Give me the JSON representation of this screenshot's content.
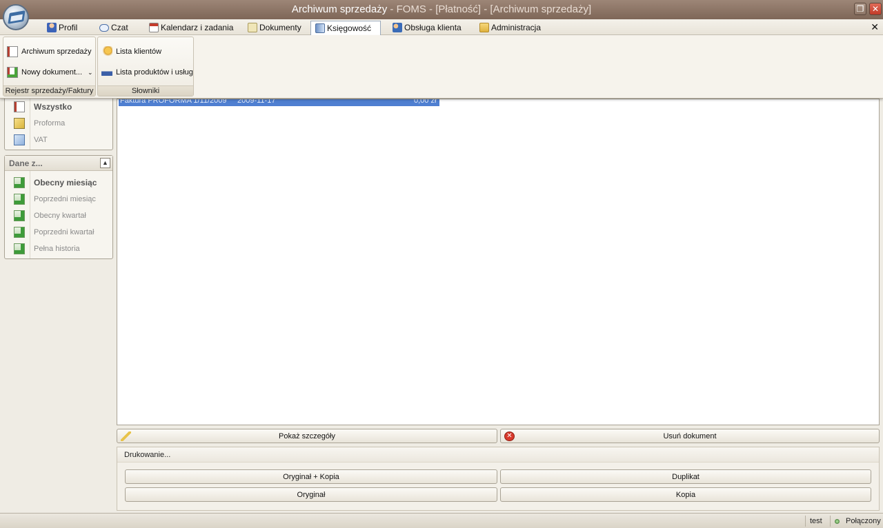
{
  "window": {
    "title_main": "Archiwum sprzedaży",
    "title_rest": " - FOMS - [Płatność] - [Archiwum sprzedaży]"
  },
  "tabs": [
    {
      "label": "Profil"
    },
    {
      "label": "Czat"
    },
    {
      "label": "Kalendarz i zadania"
    },
    {
      "label": "Dokumenty"
    },
    {
      "label": "Księgowość"
    },
    {
      "label": "Obsługa klienta"
    },
    {
      "label": "Administracja"
    }
  ],
  "ribbon": {
    "group1": {
      "caption": "Rejestr sprzedaży/Faktury",
      "archive_label": "Archiwum sprzedaży",
      "new_doc_label": "Nowy dokument..."
    },
    "group2": {
      "caption": "Słowniki",
      "clients_label": "Lista klientów",
      "products_label": "Lista produktów i usług"
    }
  },
  "sidebar": {
    "type_items": [
      {
        "label": "Wszystko"
      },
      {
        "label": "Proforma"
      },
      {
        "label": "VAT"
      }
    ],
    "date_panel": {
      "title": "Dane z...",
      "items": [
        {
          "label": "Obecny miesiąc"
        },
        {
          "label": "Poprzedni miesiąc"
        },
        {
          "label": "Obecny kwartał"
        },
        {
          "label": "Poprzedni kwartał"
        },
        {
          "label": "Pełna historia"
        }
      ]
    }
  },
  "grid": {
    "rows": [
      {
        "doc": "Faktura PROFORMA 1/11/2009",
        "date": "2009-11-17",
        "client": "",
        "amount": "0,00 zł"
      }
    ]
  },
  "actions": {
    "details_label": "Pokaż szczegóły",
    "delete_label": "Usuń dokument"
  },
  "print": {
    "title": "Drukowanie...",
    "orig_copy_label": "Oryginał + Kopia",
    "duplicate_label": "Duplikat",
    "original_label": "Oryginał",
    "copy_label": "Kopia"
  },
  "status": {
    "user": "test",
    "connection": "Połączony"
  },
  "colors": {
    "titlebar": "#8b7364",
    "selection": "#4f7fd1",
    "close": "#d14a37"
  }
}
